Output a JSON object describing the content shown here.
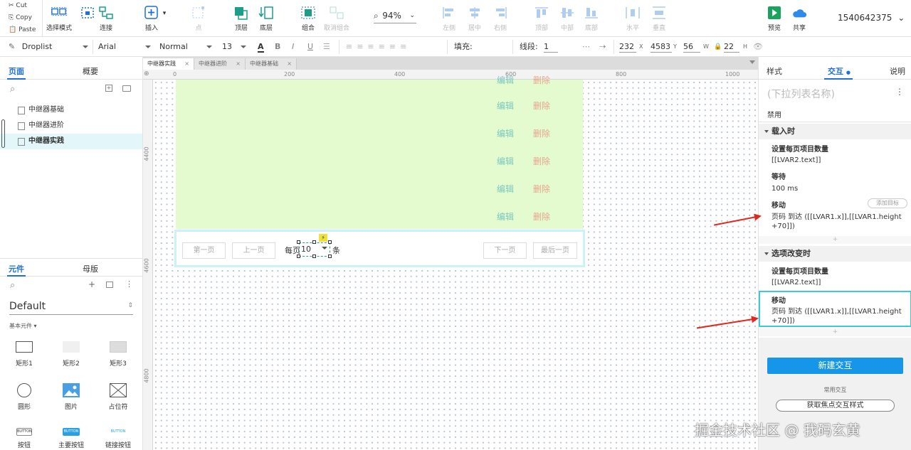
{
  "clipboard": {
    "cut": "Cut",
    "copy": "Copy",
    "paste": "Paste"
  },
  "toolbar": {
    "select_mode": "选择模式",
    "connect": "连接",
    "insert": "插入",
    "dot": "点",
    "top_layer": "顶层",
    "bottom_layer": "底层",
    "group": "组合",
    "ungroup": "取消组合",
    "zoom": "94%",
    "align_left": "左侧",
    "align_center": "居中",
    "align_right": "右侧",
    "align_top": "顶部",
    "align_middle": "中部",
    "align_bottom": "底部",
    "dist_h": "水平",
    "dist_v": "垂直",
    "preview": "预览",
    "share": "共享",
    "user": "1540642375"
  },
  "format": {
    "widget_type": "Droplist",
    "font": "Arial",
    "weight": "Normal",
    "size": "13",
    "fill_label": "填充:",
    "line_label": "线段:",
    "line_value": "1",
    "x": "232",
    "x_label": "X",
    "y": "4583",
    "y_label": "Y",
    "w": "56",
    "w_label": "W",
    "h": "22",
    "h_label": "H"
  },
  "left": {
    "tab_pages": "页面",
    "tab_outline": "概要",
    "pages": [
      {
        "name": "中继器基础"
      },
      {
        "name": "中继器进阶"
      },
      {
        "name": "中继器实践"
      }
    ],
    "tab_widgets": "元件",
    "tab_masters": "母版",
    "library": "Default",
    "category": "基本元件 ▾",
    "widgets": [
      {
        "label": "矩形1"
      },
      {
        "label": "矩形2"
      },
      {
        "label": "矩形3"
      },
      {
        "label": "圆形"
      },
      {
        "label": "图片"
      },
      {
        "label": "占位符"
      },
      {
        "label": "按钮"
      },
      {
        "label": "主要按钮"
      },
      {
        "label": "链接按钮"
      }
    ],
    "button_text": "BUTTON"
  },
  "doc_tabs": [
    {
      "label": "中继器实践"
    },
    {
      "label": "中继器进阶"
    },
    {
      "label": "中继器基础"
    }
  ],
  "ruler": {
    "h": [
      "0",
      "200",
      "400",
      "600",
      "800",
      "1000"
    ],
    "v": [
      "4400",
      "4600",
      "4800"
    ]
  },
  "canvas": {
    "edit": "编辑",
    "delete": "删除",
    "first": "第一页",
    "prev": "上一页",
    "per_page_pre": "每页",
    "per_page_value": "10",
    "per_page_post": "条",
    "next": "下一页",
    "last": "最后一页"
  },
  "right": {
    "tab_style": "样式",
    "tab_interact": "交互",
    "tab_notes": "说明",
    "name_placeholder": "(下拉列表名称)",
    "disabled": "禁用",
    "sec1": "载入时",
    "set_items": "设置每页项目数量",
    "lvar2": "[[LVAR2.text]]",
    "wait": "等待",
    "wait_value": "100 ms",
    "move": "移动",
    "add_target": "添加目标",
    "move_value": "页码 到达 ([[LVAR1.x]],[[LVAR1.height +70]])",
    "sec2": "选项改变时",
    "set_items2": "设置每页项目数量",
    "lvar2b": "[[LVAR2.text]]",
    "move2": "移动",
    "move_value2": "页码 到达 ([[LVAR1.x]],[[LVAR1.height +70]])",
    "new_interaction": "新建交互",
    "common": "常用交互",
    "focus_style": "获取焦点交互样式"
  },
  "watermark": "掘金技术社区 @ 我码玄黄",
  "colors": {
    "accent": "#1e6fd9",
    "green_bg": "#e3fbcf",
    "edit": "#7bc8c0",
    "delete": "#e7a48e",
    "arrow": "#e0281e"
  }
}
